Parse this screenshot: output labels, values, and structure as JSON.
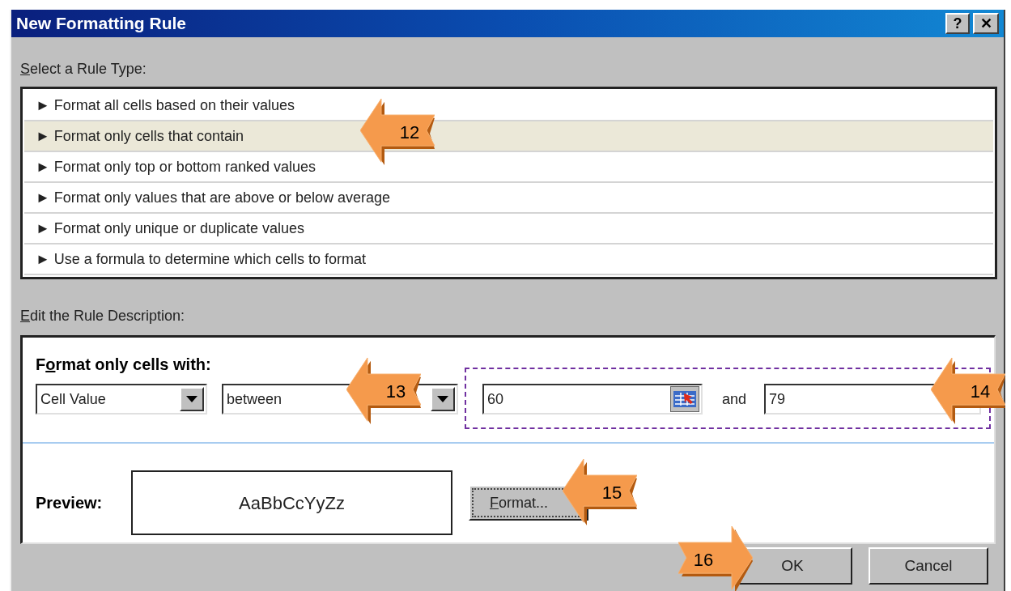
{
  "window": {
    "title": "New Formatting Rule",
    "help_button": "?",
    "close_button": "✕"
  },
  "rule_type_label": {
    "key": "S",
    "after": "elect a Rule Type:"
  },
  "rule_types": [
    {
      "label": "Format all cells based on their values",
      "selected": false
    },
    {
      "label": "Format only cells that contain",
      "selected": true
    },
    {
      "label": "Format only top or bottom ranked values",
      "selected": false
    },
    {
      "label": "Format only values that are above or below average",
      "selected": false
    },
    {
      "label": "Format only unique or duplicate values",
      "selected": false
    },
    {
      "label": "Use a formula to determine which cells to format",
      "selected": false
    }
  ],
  "rule_type_marker": "►",
  "description_label": {
    "key": "E",
    "after": "dit the Rule Description:"
  },
  "description": {
    "heading": {
      "before": "F",
      "key": "o",
      "after": "rmat only cells with:"
    },
    "condition_type": "Cell Value",
    "operator": "between",
    "value_1": "60",
    "conjunction": "and",
    "value_2": "79",
    "preview_label": "Preview:",
    "preview_sample": "AaBbCcYyZz",
    "format_button": {
      "key": "F",
      "after": "ormat..."
    }
  },
  "buttons": [
    "OK",
    "Cancel"
  ],
  "callouts": [
    {
      "number": "12",
      "kind": "left"
    },
    {
      "number": "13",
      "kind": "left"
    },
    {
      "number": "14",
      "kind": "left"
    },
    {
      "number": "15",
      "kind": "left"
    },
    {
      "number": "16",
      "kind": "right"
    }
  ]
}
